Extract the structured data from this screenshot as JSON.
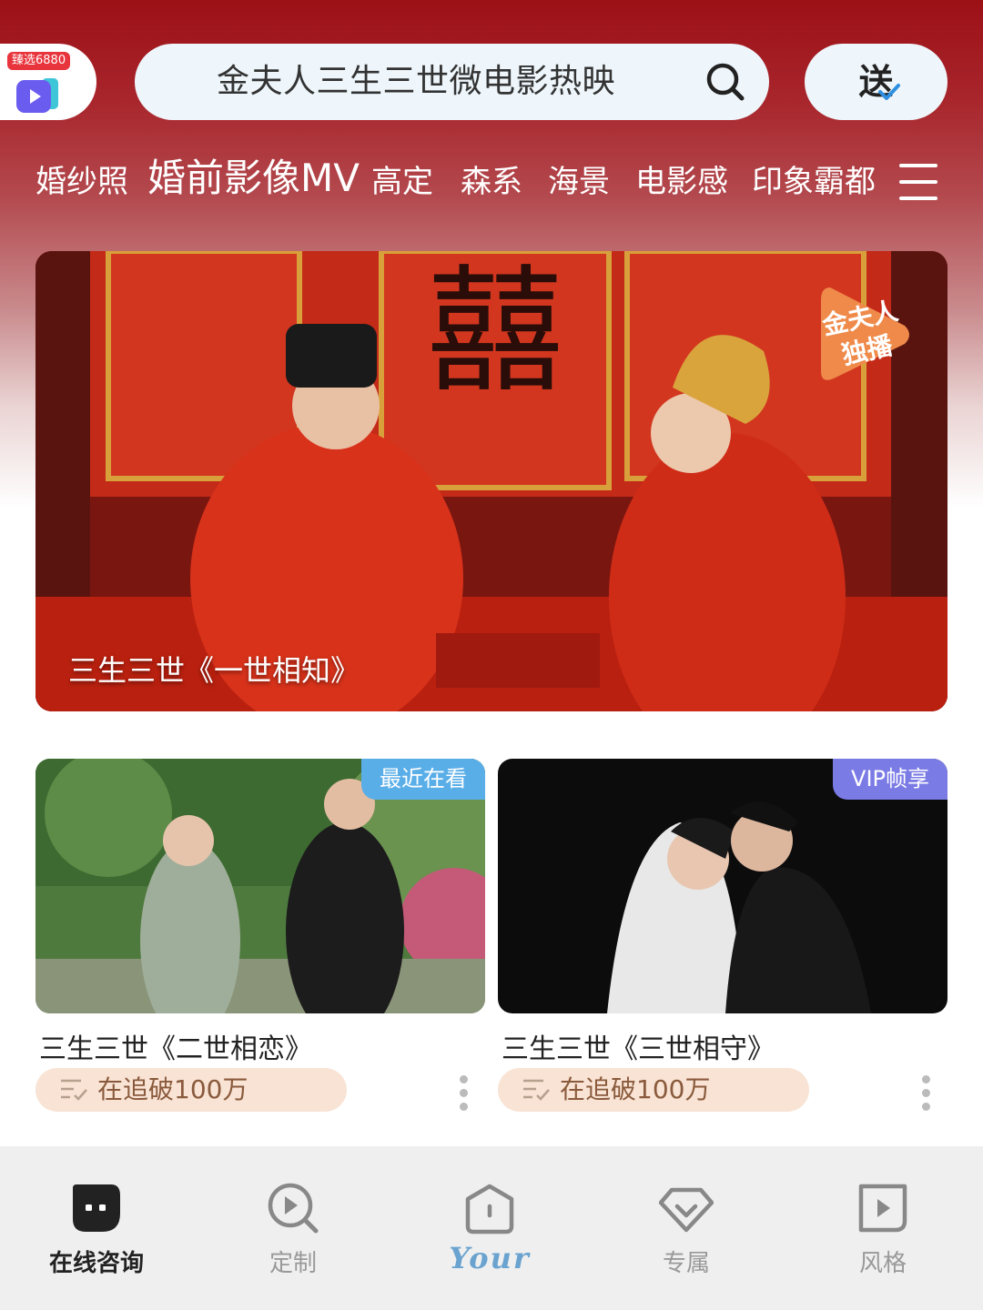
{
  "header": {
    "app_badge": "臻选6880",
    "search_text": "金夫人三生三世微电影热映",
    "send_label": "送"
  },
  "categories": [
    "婚纱照",
    "婚前影像MV",
    "高定",
    "森系",
    "海景",
    "电影感",
    "印象霸都"
  ],
  "active_category": "婚前影像MV",
  "hero": {
    "caption": "三生三世《一世相知》",
    "logo_text": "金夫人\n独播"
  },
  "cards": [
    {
      "badge": "最近在看",
      "badge_color": "#5aaee8",
      "title": "三生三世《二世相恋》",
      "pill_text": "在追破100万"
    },
    {
      "badge": "VIP帧享",
      "badge_color": "#7b7be6",
      "title": "三生三世《三世相守》",
      "pill_text": "在追破100万"
    }
  ],
  "bottom_nav": [
    {
      "label": "在线咨询",
      "icon": "chat-bubble-icon",
      "active": true
    },
    {
      "label": "定制",
      "icon": "search-play-icon",
      "active": false
    },
    {
      "label": "Your",
      "icon": "home-icon",
      "active": false
    },
    {
      "label": "专属",
      "icon": "diamond-icon",
      "active": false
    },
    {
      "label": "风格",
      "icon": "play-square-icon",
      "active": false
    }
  ],
  "colors": {
    "header_red": "#9c1016",
    "search_bg": "#eef6fb",
    "pill_bg": "#f8e3d4",
    "your_blue": "#6aa3cf"
  }
}
